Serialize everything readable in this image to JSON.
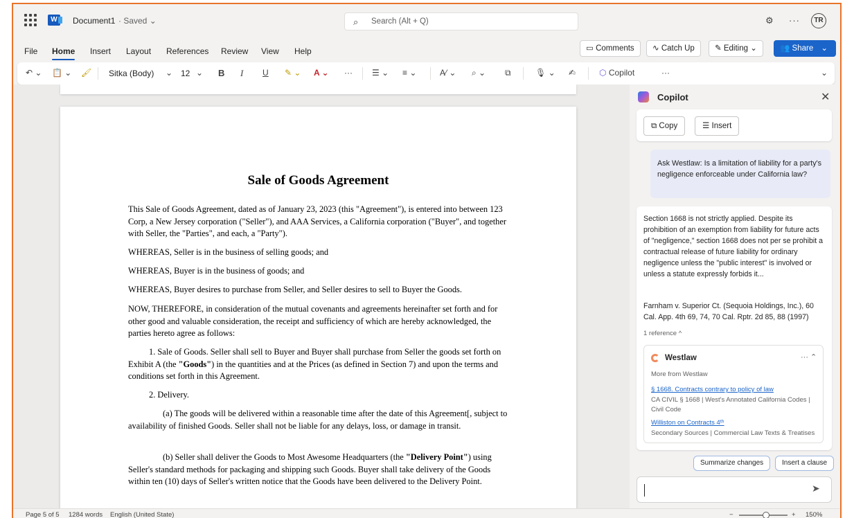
{
  "titlebar": {
    "doc_name": "Document1",
    "saved_status": "· Saved ⌄",
    "search_placeholder": "Search (Alt + Q)",
    "user_initials": "TR"
  },
  "menu": {
    "tabs": [
      "File",
      "Home",
      "Insert",
      "Layout",
      "References",
      "Review",
      "View",
      "Help"
    ],
    "active_tab": "Home",
    "comments_label": "Comments",
    "catchup_label": "Catch Up",
    "editing_label": "Editing",
    "share_label": "Share"
  },
  "ribbon": {
    "font_name": "Sitka (Body)",
    "font_size": "12",
    "copilot_label": "Copilot"
  },
  "document": {
    "title": "Sale of Goods Agreement",
    "p1": "This Sale of Goods Agreement, dated as of January 23, 2023 (this \"Agreement\"), is entered into between 123 Corp, a New Jersey corporation (\"Seller\"), and AAA Services, a California corporation (\"Buyer\", and together with Seller, the \"Parties\", and each, a \"Party\").",
    "p2": "WHEREAS, Seller is in the business of selling goods; and",
    "p3": "WHEREAS, Buyer is in the business of goods; and",
    "p4": "WHEREAS, Buyer desires to purchase from Seller, and Seller desires to sell to Buyer the Goods.",
    "p5": "NOW, THEREFORE, in consideration of the mutual covenants and agreements hereinafter set forth and for other good and valuable consideration, the receipt and sufficiency of which are hereby acknowledged, the parties hereto agree as follows:",
    "p6_a": "1.    Sale of Goods. Seller shall sell to Buyer and Buyer shall purchase from Seller the goods set forth on Exhibit A (the ",
    "p6_bold": "\"Goods\"",
    "p6_b": ") in the quantities and at the Prices (as defined in Section 7) and upon the terms and conditions set forth in this Agreement.",
    "p7": "2.    Delivery.",
    "p8": "(a)    The goods will be delivered within a reasonable time after the date of this Agreement[, subject to availability of finished Goods. Seller shall not be liable for any delays, loss, or damage in transit.",
    "p9_a": "(b)    Seller shall deliver the Goods to Most Awesome Headquarters (the ",
    "p9_bold": "\"Delivery Point\"",
    "p9_b": ") using Seller's standard methods for packaging and shipping such Goods. Buyer shall take delivery of the Goods within ten (10) days of Seller's written notice that the Goods have been delivered to the Delivery Point."
  },
  "copilot": {
    "title": "Copilot",
    "copy_label": "Copy",
    "insert_label": "Insert",
    "user_message": "Ask Westlaw: Is a limitation of liability for a party's negligence enforceable under California law?",
    "answer": "Section 1668 is not strictly applied. Despite its prohibition of an exemption from liability for future acts of \"negligence,\" section 1668 does not per se prohibit a contractual release of future liability for ordinary negligence unless the \"public interest\" is involved or unless a statute expressly forbids it...",
    "citation": "Farnham v. Superior Ct. (Sequoia Holdings, Inc.), 60 Cal. App. 4th 69, 74, 70 Cal. Rptr. 2d 85, 88 (1997)",
    "references_label": "1 reference ^",
    "westlaw": {
      "name": "Westlaw",
      "more_from": "More from Westlaw",
      "link1": "§ 1668. Contracts contrary to policy of law",
      "link1_sub": "CA CIVIL § 1668 | West's Annotated California Codes | Civil Code",
      "link2": "Williston on Contracts 4ᵗʰ",
      "link2_sub": "Secondary Sources | Commercial Law Texts & Treatises"
    },
    "suggestion1": "Summarize changes",
    "suggestion2": "Insert a clause"
  },
  "statusbar": {
    "page": "Page 5 of 5",
    "words": "1284 words",
    "language": "English (United State)",
    "zoom": "150%"
  }
}
